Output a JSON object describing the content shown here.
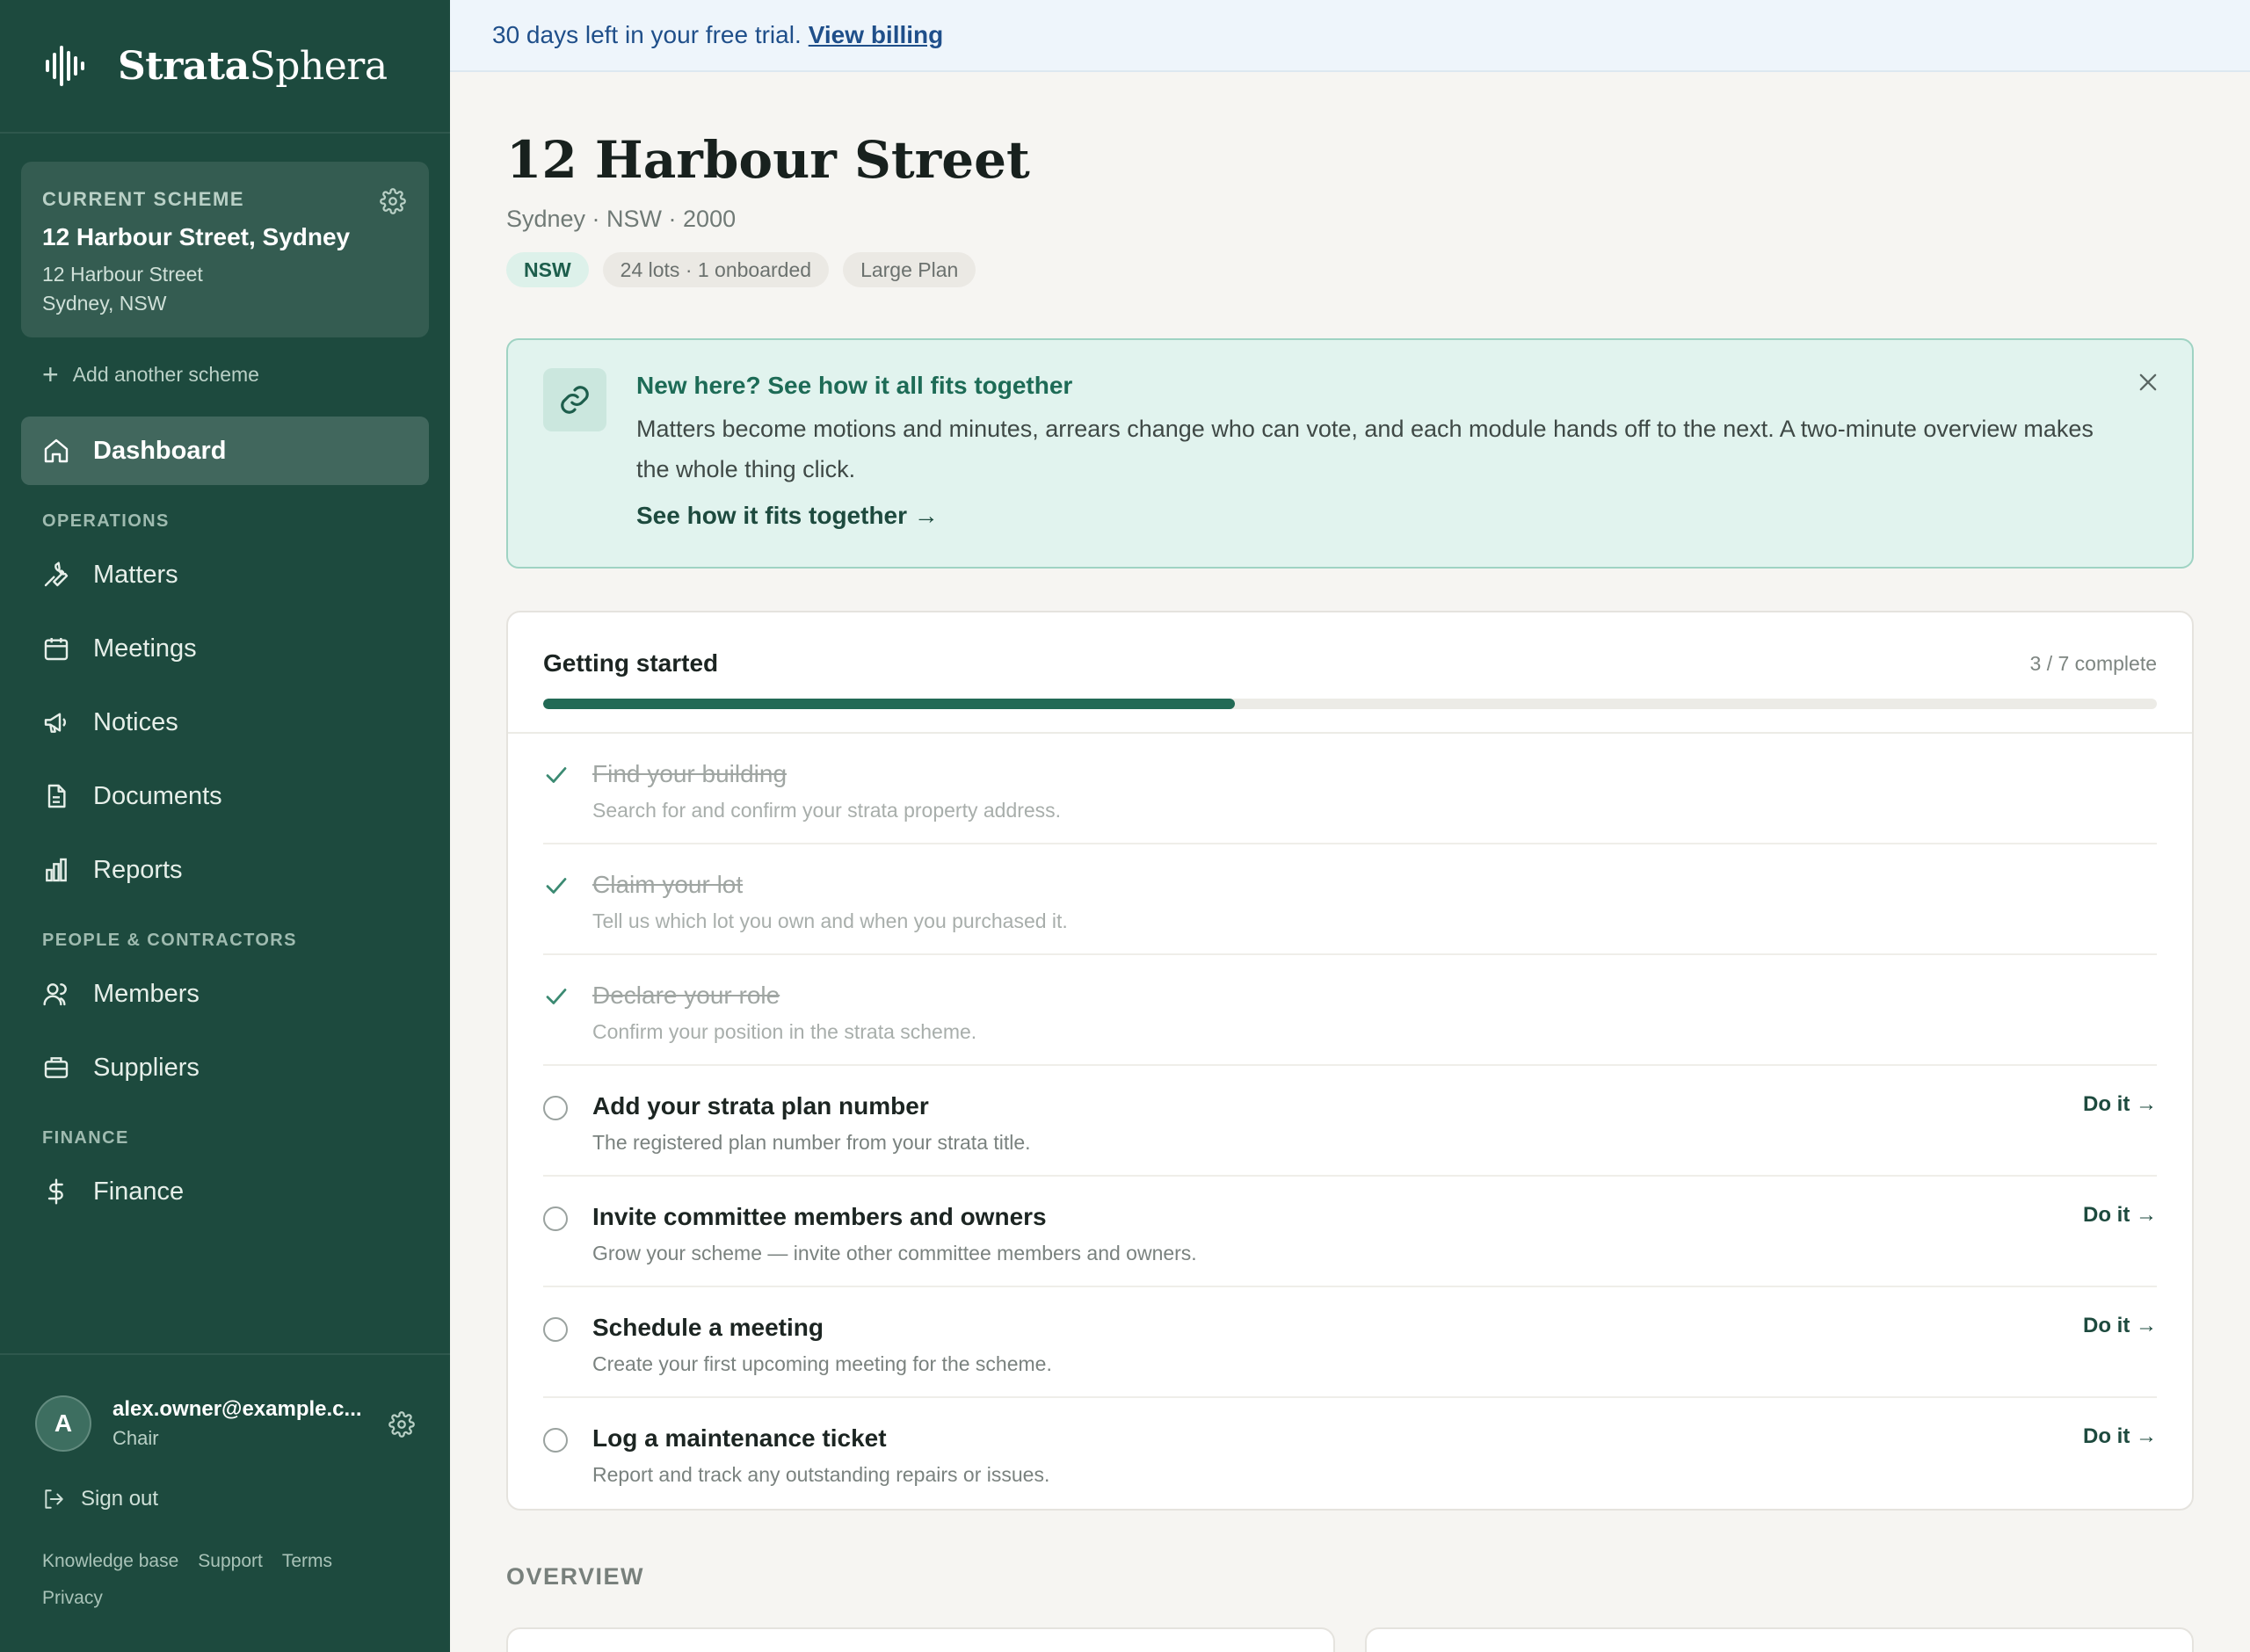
{
  "brand": {
    "name_bold": "Strata",
    "name_light": "Sphera"
  },
  "scheme": {
    "label": "CURRENT SCHEME",
    "name": "12 Harbour Street, Sydney",
    "address_line1": "12 Harbour Street",
    "address_line2": "Sydney, NSW",
    "add_label": "Add another scheme"
  },
  "nav": {
    "dashboard": "Dashboard",
    "sections": {
      "operations": "OPERATIONS",
      "people": "PEOPLE & CONTRACTORS",
      "finance": "FINANCE"
    },
    "items": {
      "matters": "Matters",
      "meetings": "Meetings",
      "notices": "Notices",
      "documents": "Documents",
      "reports": "Reports",
      "members": "Members",
      "suppliers": "Suppliers",
      "finance": "Finance"
    }
  },
  "user": {
    "initial": "A",
    "email": "alex.owner@example.c...",
    "role": "Chair",
    "signout": "Sign out"
  },
  "footer": {
    "kb": "Knowledge base",
    "support": "Support",
    "terms": "Terms",
    "privacy": "Privacy"
  },
  "trial": {
    "text": "30 days left in your free trial.",
    "link": "View billing"
  },
  "page": {
    "title": "12 Harbour Street",
    "subtitle": "Sydney · NSW · 2000",
    "chips": {
      "state": "NSW",
      "lots": "24 lots · 1 onboarded",
      "plan": "Large Plan"
    }
  },
  "banner": {
    "title": "New here? See how it all fits together",
    "text": "Matters become motions and minutes, arrears change who can vote, and each module hands off to the next. A two-minute overview makes the whole thing click.",
    "link": "See how it fits together →"
  },
  "getting_started": {
    "title": "Getting started",
    "count": "3 / 7 complete",
    "progress": 0.4286,
    "tasks": [
      {
        "title": "Find your building",
        "desc": "Search for and confirm your strata property address.",
        "done": true
      },
      {
        "title": "Claim your lot",
        "desc": "Tell us which lot you own and when you purchased it.",
        "done": true
      },
      {
        "title": "Declare your role",
        "desc": "Confirm your position in the strata scheme.",
        "done": true
      },
      {
        "title": "Add your strata plan number",
        "desc": "The registered plan number from your strata title.",
        "done": false,
        "action": "Do it →"
      },
      {
        "title": "Invite committee members and owners",
        "desc": "Grow your scheme — invite other committee members and owners.",
        "done": false,
        "action": "Do it →"
      },
      {
        "title": "Schedule a meeting",
        "desc": "Create your first upcoming meeting for the scheme.",
        "done": false,
        "action": "Do it →"
      },
      {
        "title": "Log a maintenance ticket",
        "desc": "Report and track any outstanding repairs or issues.",
        "done": false,
        "action": "Do it →"
      }
    ]
  },
  "overview": {
    "label": "OVERVIEW"
  },
  "colors": {
    "sidebar": "#1d4a3e",
    "accent": "#226a55",
    "banner_bg": "#e1f3ee",
    "trial_bg": "#eef5fb"
  }
}
